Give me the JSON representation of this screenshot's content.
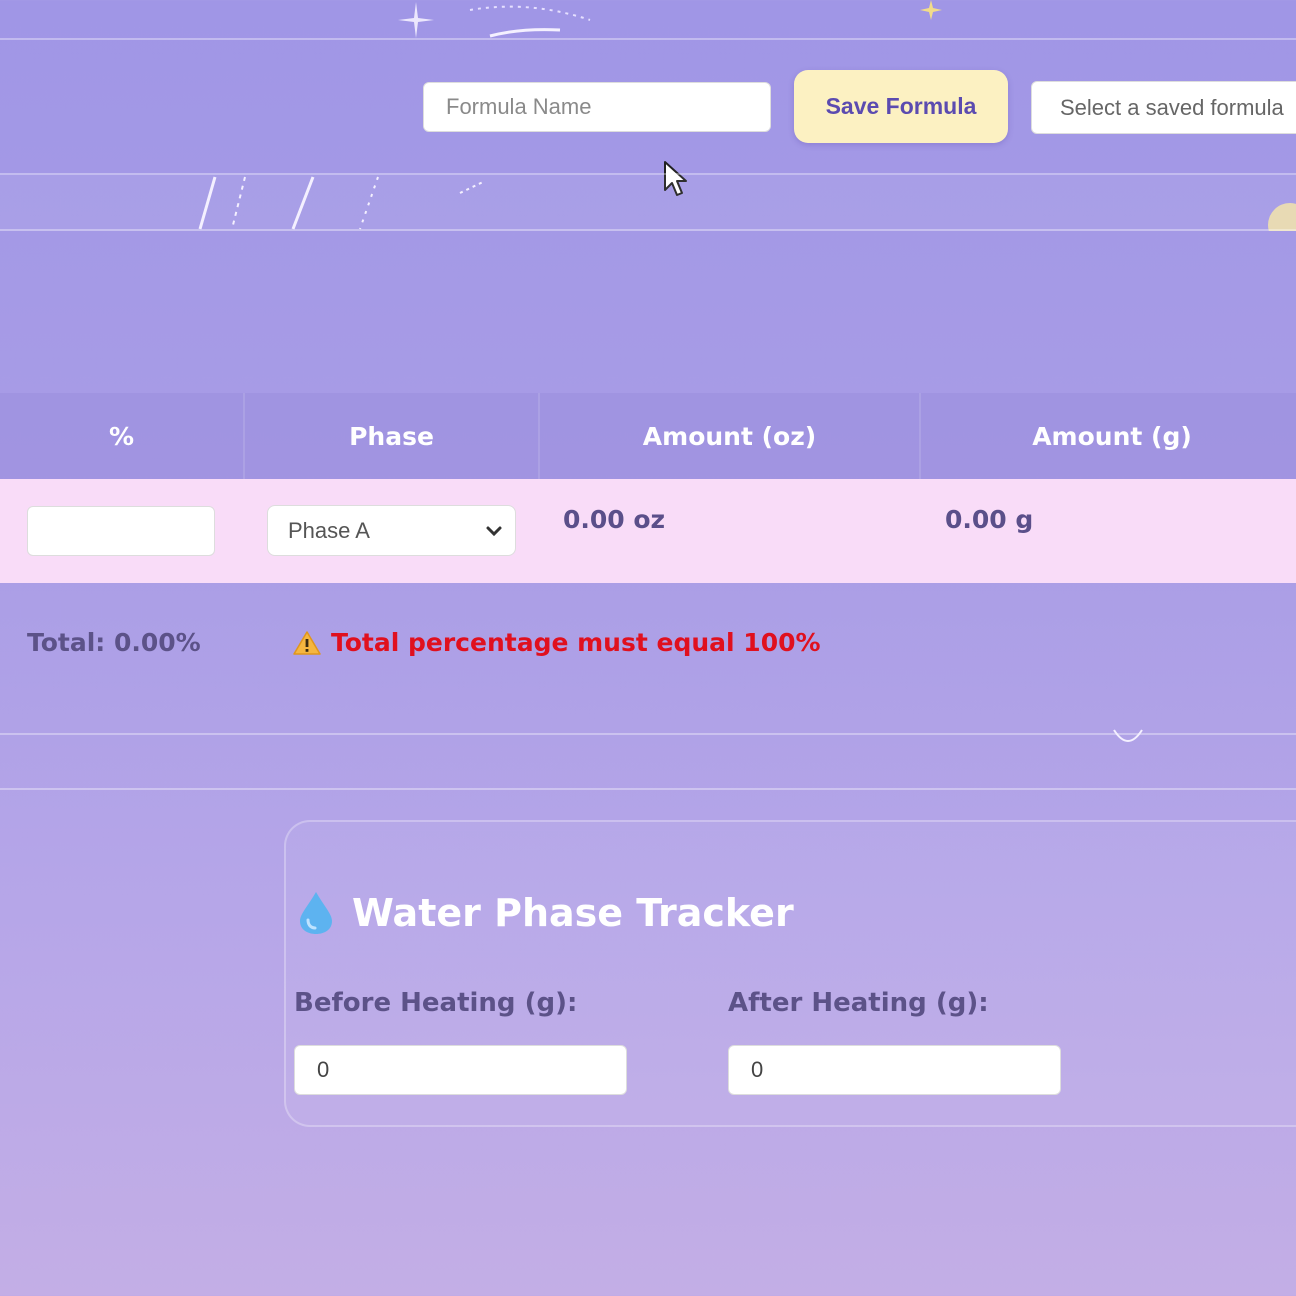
{
  "toolbar": {
    "formula_name_placeholder": "Formula Name",
    "save_label": "Save Formula",
    "saved_select_text": "Select a saved formula"
  },
  "table": {
    "headers": [
      "%",
      "Phase",
      "Amount (oz)",
      "Amount (g)"
    ],
    "row": {
      "percent_value": "",
      "phase_value": "Phase A",
      "amount_oz": "0.00 oz",
      "amount_g": "0.00 g"
    }
  },
  "summary": {
    "total": "Total: 0.00%",
    "warning": "Total percentage must equal 100%"
  },
  "tracker": {
    "title": "Water Phase Tracker",
    "before_label": "Before Heating (g):",
    "before_value": "0",
    "after_label": "After Heating (g):",
    "after_value": "0"
  },
  "colors": {
    "accent": "#5b4bb0",
    "save_button_bg": "#fcf1c2",
    "row_bg": "#f9dcf8",
    "warning": "#e0101e"
  },
  "icons": {
    "warning": "warning-icon",
    "water": "water-drop-icon",
    "cursor": "mouse-cursor-icon",
    "dropdown": "chevron-down-icon"
  }
}
